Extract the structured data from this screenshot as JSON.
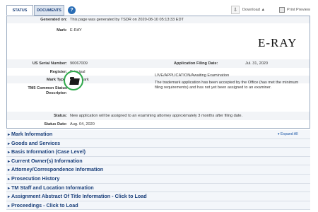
{
  "tabs": {
    "status": "STATUS",
    "documents": "DOCUMENTS"
  },
  "toolbar": {
    "help": "?",
    "download": "Download",
    "print": "Print Preview"
  },
  "record": {
    "generated_label": "Generated on:",
    "generated_value": "This page was generated by TSDR on 2020-08-10 05:13:33 EDT",
    "mark_label": "Mark:",
    "mark_value": "E-RAY",
    "mark_image_text": "E-RAY",
    "serial_label": "US Serial Number:",
    "serial_value": "90067009",
    "filing_label": "Application Filing Date:",
    "filing_value": "Jul. 31, 2020",
    "register_label": "Register:",
    "register_value": "Principal",
    "mark_type_label": "Mark Type:",
    "mark_type_value": "Trademark",
    "tm5_label": "TM5 Common Status Descriptor:",
    "tm5_title": "LIVE/APPLICATION/Awaiting Examination",
    "tm5_description": "The trademark application has been accepted by the Office (has met the minimum filing requirements) and has not yet been assigned to an examiner.",
    "status_label": "Status:",
    "status_value": "New application will be assigned to an examining attorney approximately 3 months after filing date.",
    "status_date_label": "Status Date:",
    "status_date_value": "Aug. 04, 2020"
  },
  "expand_all": "▾ Expand All",
  "sections": [
    "Mark Information",
    "Goods and Services",
    "Basis Information (Case Level)",
    "Current Owner(s) Information",
    "Attorney/Correspondence Information",
    "Prosecution History",
    "TM Staff and Location Information",
    "Assignment Abstract Of Title Information - Click to Load",
    "Proceedings - Click to Load"
  ],
  "colors": {
    "section_text": "#1a3f7a",
    "status_ring": "#2ea84a",
    "help_icon": "#2a6db5"
  }
}
